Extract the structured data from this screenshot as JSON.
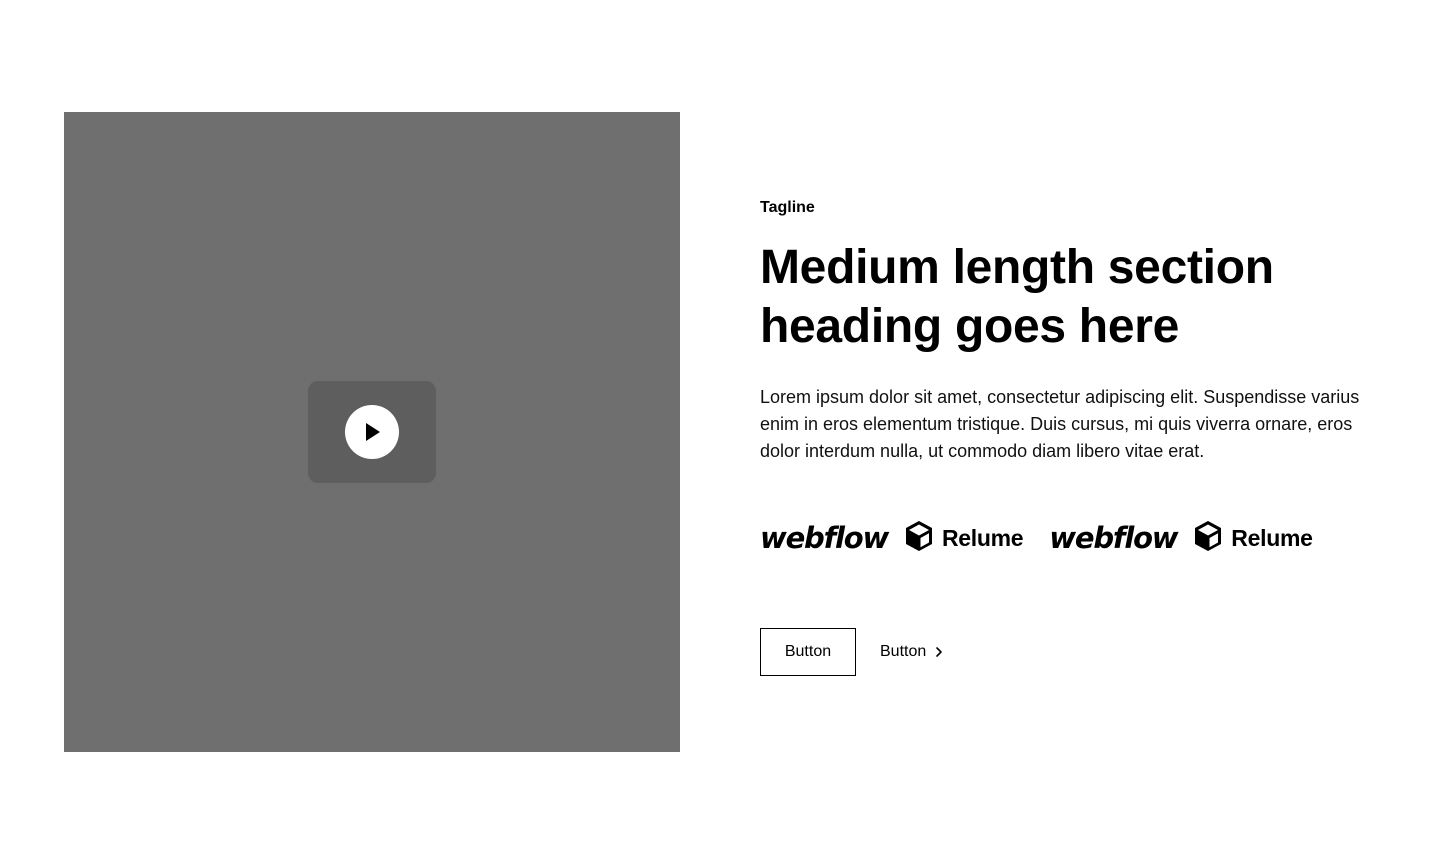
{
  "media": {
    "play_icon": "play-icon"
  },
  "content": {
    "tagline": "Tagline",
    "heading": "Medium length section heading goes here",
    "body": "Lorem ipsum dolor sit amet, consectetur adipiscing elit. Suspendisse varius enim in eros elementum tristique. Duis cursus, mi quis viverra ornare, eros dolor interdum nulla, ut commodo diam libero vitae erat."
  },
  "logos": [
    {
      "type": "webflow",
      "text": "webflow"
    },
    {
      "type": "relume",
      "text": "Relume",
      "icon": "cube-icon"
    },
    {
      "type": "webflow",
      "text": "webflow"
    },
    {
      "type": "relume",
      "text": "Relume",
      "icon": "cube-icon"
    }
  ],
  "buttons": {
    "primary_label": "Button",
    "secondary_label": "Button",
    "secondary_icon": "chevron-right-icon"
  },
  "colors": {
    "video_bg": "#6f6f6f",
    "play_wrap_bg": "#5e5e5e",
    "text": "#000000",
    "background": "#ffffff"
  }
}
